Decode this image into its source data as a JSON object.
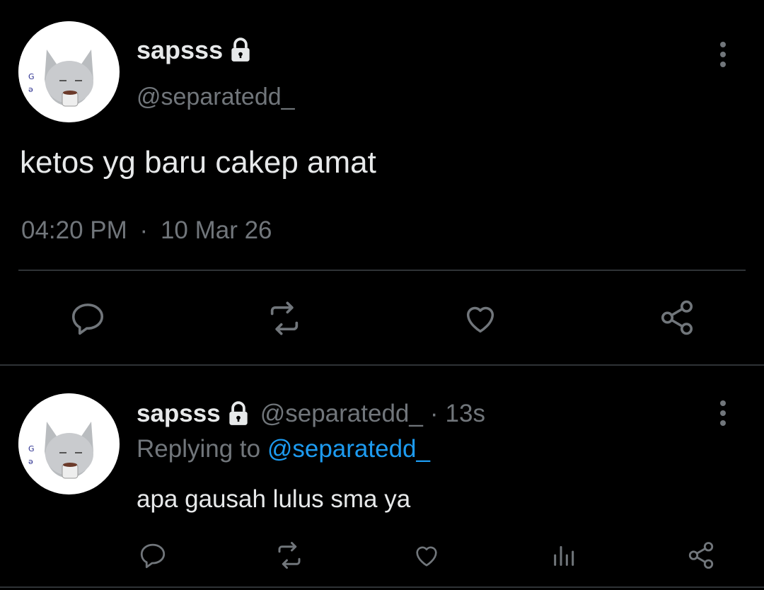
{
  "colors": {
    "background": "#000000",
    "text": "#e7e9ea",
    "muted": "#71767b",
    "link": "#1d9bf0",
    "divider": "#2f3336"
  },
  "main_tweet": {
    "display_name": "sapsss",
    "handle": "@separatedd_",
    "text": "ketos yg baru cakep amat",
    "time": "04:20 PM",
    "separator": "·",
    "date": "10 Mar 26",
    "more_icon": "more-vertical-icon",
    "lock_icon": "lock-icon",
    "actions": [
      "reply-icon",
      "retweet-icon",
      "like-icon",
      "share-icon"
    ]
  },
  "reply_tweet": {
    "display_name": "sapsss",
    "handle": "@separatedd_",
    "separator": "·",
    "age": "13s",
    "replying_prefix": "Replying to",
    "replying_handle": "@separatedd_",
    "text": "apa gausah lulus sma ya",
    "actions": [
      "reply-icon",
      "retweet-icon",
      "like-icon",
      "analytics-icon",
      "share-icon"
    ]
  }
}
